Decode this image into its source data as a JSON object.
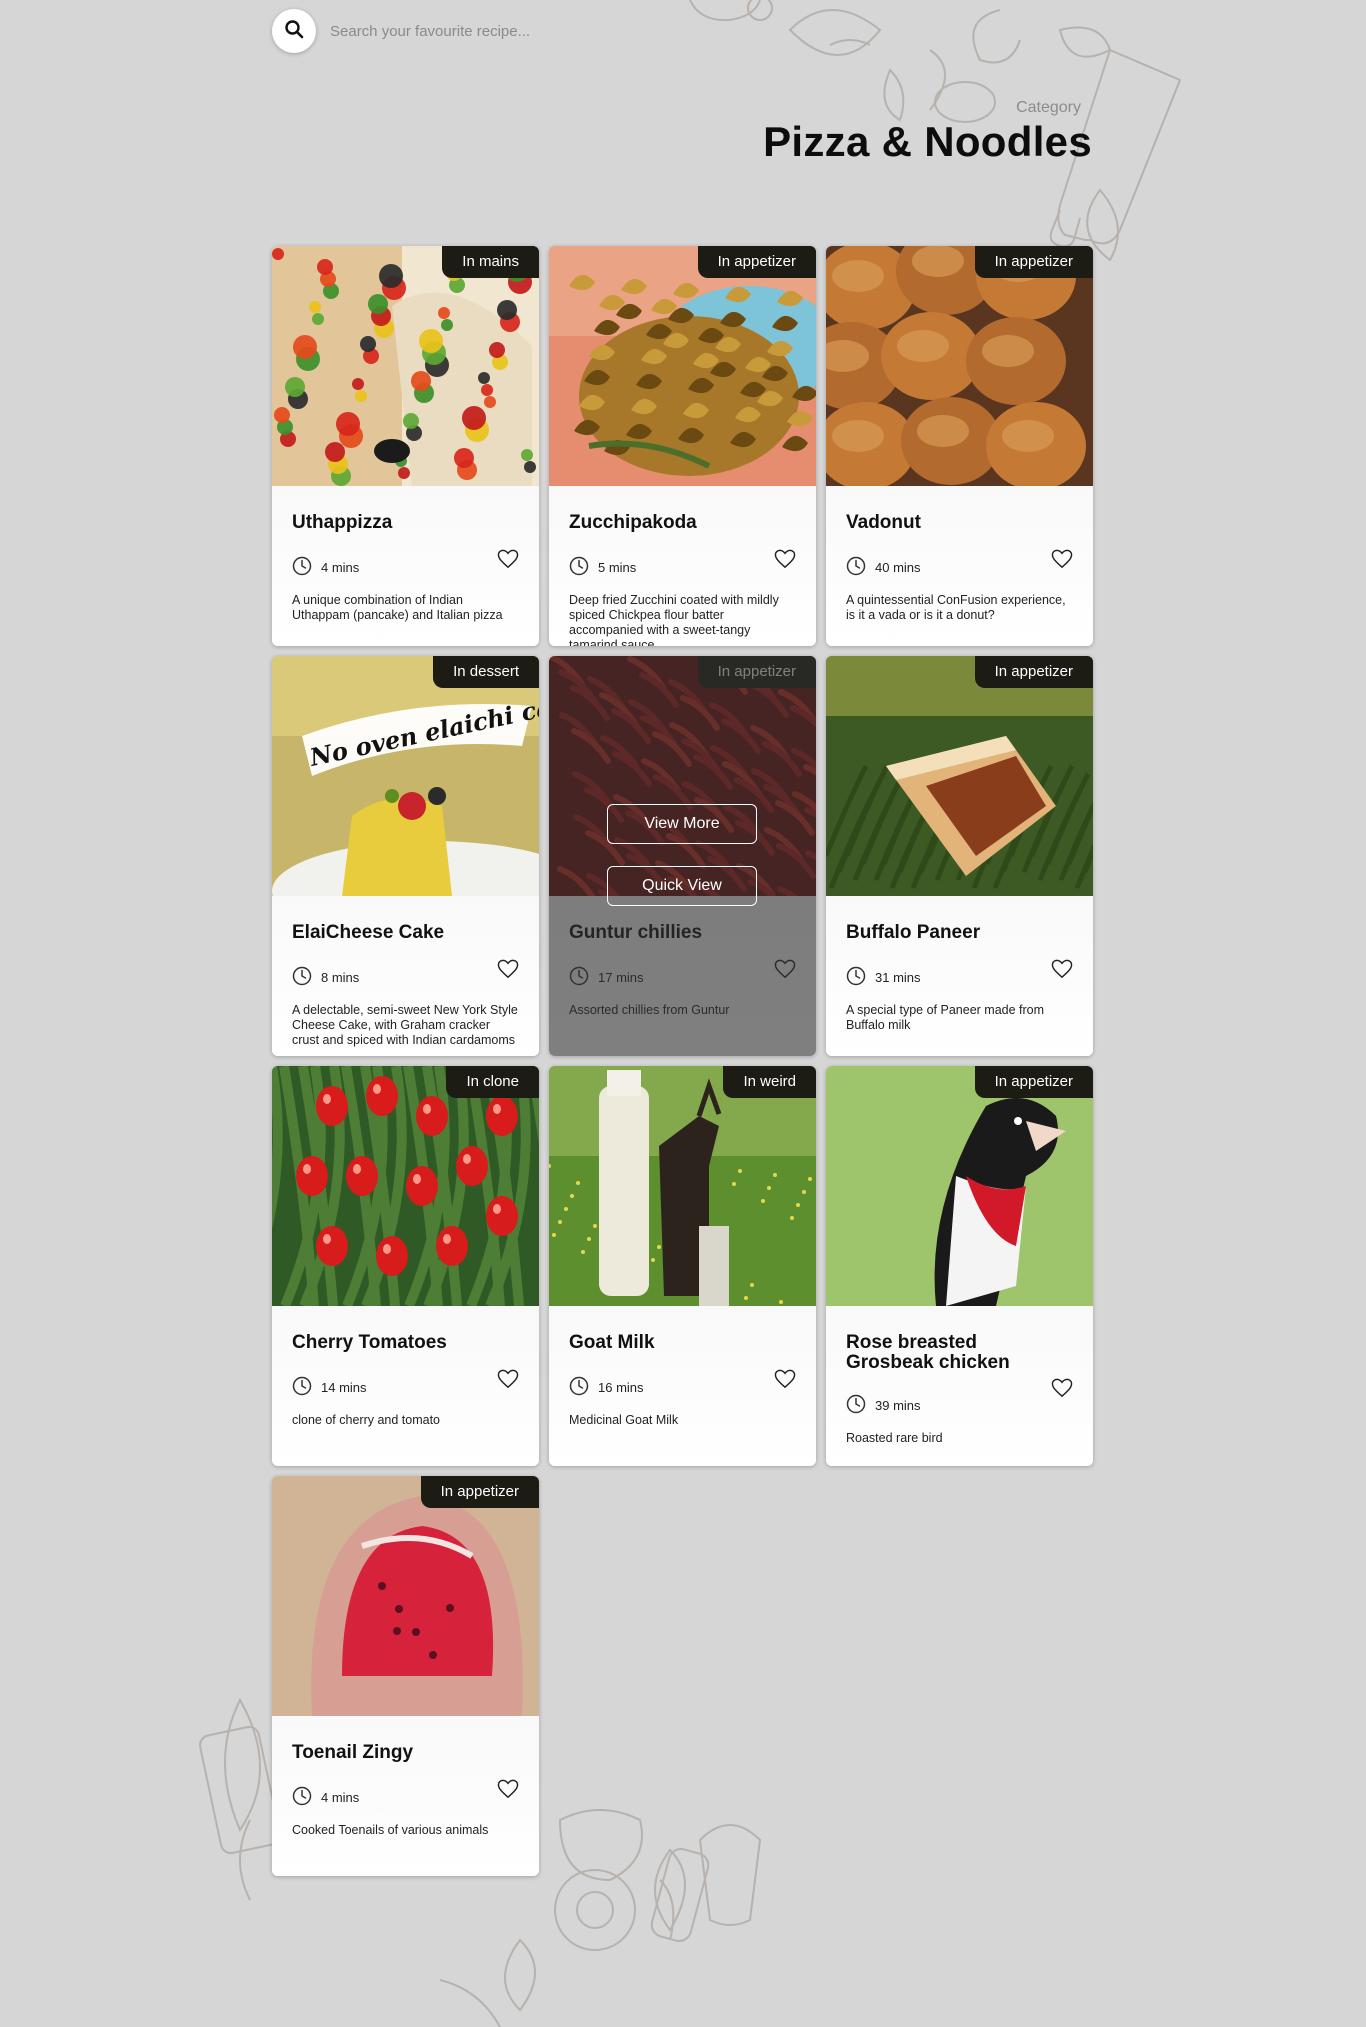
{
  "search": {
    "placeholder": "Search your favourite recipe..."
  },
  "header": {
    "category_label": "Category",
    "title": "Pizza & Noodles"
  },
  "overlay": {
    "view_more": "View More",
    "quick_view": "Quick View"
  },
  "recipes": [
    {
      "name": "Uthappizza",
      "category": "In mains",
      "time": "4 mins",
      "description": "A unique combination of Indian Uthappam (pancake) and Italian pizza",
      "image": "pizza"
    },
    {
      "name": "Zucchipakoda",
      "category": "In appetizer",
      "time": "5 mins",
      "description": "Deep fried Zucchini coated with mildly spiced Chickpea flour batter accompanied with a sweet-tangy tamarind sauce",
      "image": "fritters"
    },
    {
      "name": "Vadonut",
      "category": "In appetizer",
      "time": "40 mins",
      "description": "A quintessential ConFusion experience, is it a vada or is it a donut?",
      "image": "donuts"
    },
    {
      "name": "ElaiCheese Cake",
      "category": "In dessert",
      "time": "8 mins",
      "description": "A delectable, semi-sweet New York Style Cheese Cake, with Graham cracker crust and spiced with Indian cardamoms",
      "image": "cake",
      "image_text": "No oven elaichi cake"
    },
    {
      "name": "Guntur chillies",
      "category": "In appetizer",
      "time": "17 mins",
      "description": "Assorted chillies from Guntur",
      "image": "chillies",
      "hovered": true
    },
    {
      "name": "Buffalo Paneer",
      "category": "In appetizer",
      "time": "31 mins",
      "description": "A special type of Paneer made from Buffalo milk",
      "image": "paneer"
    },
    {
      "name": "Cherry Tomatoes",
      "category": "In clone",
      "time": "14 mins",
      "description": "clone of cherry and tomato",
      "image": "tomatoes"
    },
    {
      "name": "Goat Milk",
      "category": "In weird",
      "time": "16 mins",
      "description": "Medicinal Goat Milk",
      "image": "goat"
    },
    {
      "name": "Rose breasted Grosbeak chicken",
      "category": "In appetizer",
      "time": "39 mins",
      "description": "Roasted rare bird",
      "image": "bird"
    },
    {
      "name": "Toenail Zingy",
      "category": "In appetizer",
      "time": "4 mins",
      "description": "Cooked Toenails of various animals",
      "image": "toenail"
    }
  ],
  "icons": {
    "search": "search-icon",
    "clock": "clock-icon",
    "favorite": "heart-outline-icon"
  },
  "colors": {
    "background": "#d6d6d6",
    "badge": "#1c1c14",
    "card": "#ffffff"
  }
}
